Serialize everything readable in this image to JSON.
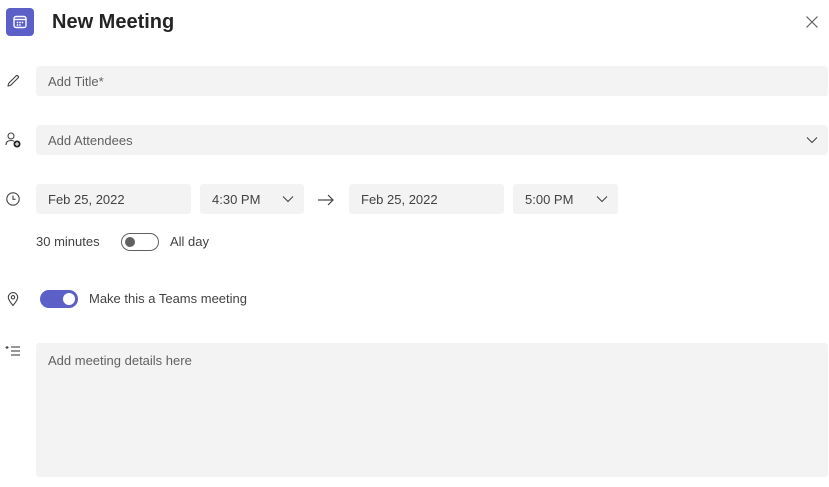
{
  "header": {
    "title": "New Meeting",
    "icon": "calendar-icon",
    "accent_color": "#5b5fc7"
  },
  "form": {
    "title_placeholder": "Add Title*",
    "attendees_placeholder": "Add Attendees",
    "start_date": "Feb 25, 2022",
    "start_time": "4:30 PM",
    "end_date": "Feb 25, 2022",
    "end_time": "5:00 PM",
    "duration": "30 minutes",
    "all_day_label": "All day",
    "all_day_on": false,
    "teams_meeting_label": "Make this a Teams meeting",
    "teams_meeting_on": true,
    "details_placeholder": "Add meeting details here"
  }
}
